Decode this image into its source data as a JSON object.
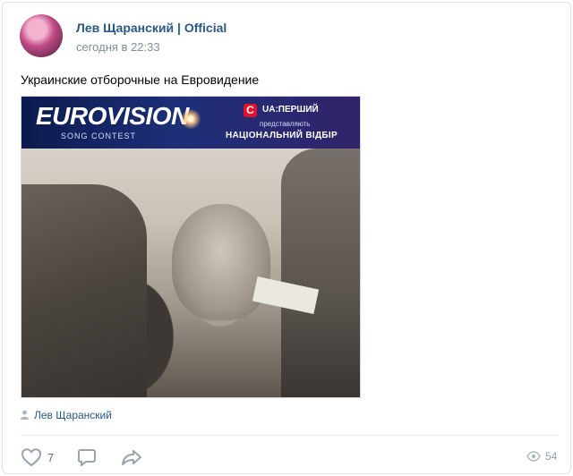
{
  "post": {
    "author": "Лев Щаранский | Official",
    "time": "сегодня в 22:33",
    "text": "Украинские отборочные на Евровидение",
    "source": "Лев Щаранский",
    "likes": "7",
    "views": "54"
  },
  "banner": {
    "logo": "EUROVISION",
    "subtitle": "SONG CONTEST",
    "channel_letter": "C",
    "channel": "UA:ПЕРШИЙ",
    "presents": "представляють",
    "selection": "НАЦІОНАЛЬНИЙ ВІДБІР"
  },
  "colors": {
    "link": "#2a5885",
    "muted": "#818c99",
    "icon": "#99a2ad",
    "banner_bg": "#0b1b4e",
    "channel_red": "#e5112c"
  },
  "icons": [
    "user-icon",
    "heart-icon",
    "comment-icon",
    "share-icon",
    "eye-icon"
  ]
}
